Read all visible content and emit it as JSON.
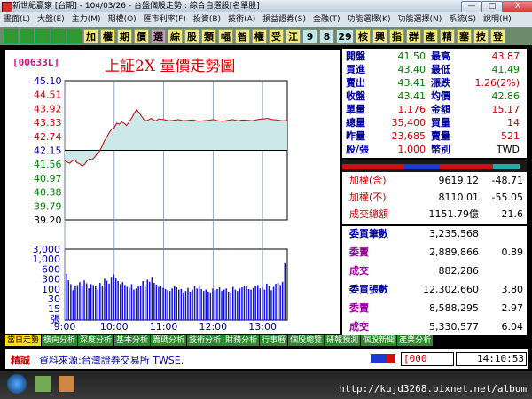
{
  "window": {
    "title": "新世紀贏家 [台期] - 104/03/26 - 台盤個股走勢 : 綜合自選股[名單股]",
    "buttons": [
      "—",
      "□",
      "X"
    ]
  },
  "menu": [
    "畫面(L)",
    "大盤(E)",
    "主力(M)",
    "期權(O)",
    "匯市利率(F)",
    "投資(B)",
    "技術(A)",
    "損益證券(S)",
    "金融(T)",
    "功能選擇(K)",
    "功能選擇(N)",
    "系統(S)",
    "說明(H)"
  ],
  "toolbar": {
    "icon_buttons": [
      "search-icon",
      "calculator-icon",
      "chart-icon",
      "grid-icon",
      "star-icon"
    ],
    "buttons": [
      "加",
      "權",
      "期",
      "價",
      "選",
      "綜",
      "股",
      "類",
      "幅",
      "智",
      "權",
      "受",
      "江",
      "9",
      "8",
      "29",
      "核",
      "興",
      "指",
      "群",
      "產",
      "精",
      "塞",
      "技",
      "登"
    ]
  },
  "stock": {
    "code": "[00633L]",
    "title": "上証2X  量價走勢圖"
  },
  "quote": [
    {
      "label": "開盤",
      "value": "41.50",
      "label2": "最高",
      "value2": "43.87"
    },
    {
      "label": "買進",
      "value": "43.40",
      "label2": "最低",
      "value2": "41.49"
    },
    {
      "label": "賣出",
      "value": "43.41",
      "label2": "漲跌",
      "value2": "1.26(2%)"
    },
    {
      "label": "收盤",
      "value": "43.41",
      "label2": "均價",
      "value2": "42.86"
    },
    {
      "label": "單量",
      "value": "1,176",
      "label2": "金額",
      "value2": "15.17"
    },
    {
      "label": "總量",
      "value": "35,400",
      "label2": "買量",
      "value2": "14"
    },
    {
      "label": "昨量",
      "value": "23,685",
      "label2": "賣量",
      "value2": "521"
    },
    {
      "label": "股/張",
      "value": "1,000",
      "label2": "幣別",
      "value2": "TWD"
    }
  ],
  "index_info": [
    {
      "label": "加權(含)",
      "value": "9619.12",
      "change": "-48.71"
    },
    {
      "label": "加權(不)",
      "value": "8110.01",
      "change": "-55.05"
    },
    {
      "label": "成交總額",
      "value": "1151.79億",
      "change": "21.6"
    }
  ],
  "volume_info": [
    {
      "label": "委買筆數",
      "value": "3,235,568",
      "change": ""
    },
    {
      "label": "委賣",
      "value": "2,889,866",
      "change": "0.89"
    },
    {
      "label": "成交",
      "value": "882,286",
      "change": ""
    },
    {
      "label": "委買張數",
      "value": "12,302,660",
      "change": "3.80"
    },
    {
      "label": "委賣",
      "value": "8,588,295",
      "change": "2.97"
    },
    {
      "label": "成交",
      "value": "5,330,577",
      "change": "6.04"
    }
  ],
  "tabs": [
    "當日走勢",
    "橫向分析",
    "深度分析",
    "基本分析",
    "籌碼分析",
    "技術分析",
    "財務分析",
    "行事曆",
    "個股總覽",
    "研報預測",
    "個股新聞",
    "產業分析"
  ],
  "status": {
    "label": "精誠",
    "source": "資料來源:台灣證券交易所 TWSE.",
    "code_box": "[000",
    "time": "14:10:53"
  },
  "watermark": "http://kujd3268.pixnet.net/album",
  "chart_data": {
    "type": "line",
    "x_ticks": [
      "9:00",
      "10:00",
      "11:00",
      "12:00",
      "13:00"
    ],
    "y_ticks": [
      "45.10",
      "44.51",
      "43.92",
      "43.33",
      "42.74",
      "42.15",
      "41.56",
      "40.97",
      "40.38",
      "39.79",
      "39.20"
    ],
    "y_tick_colors": [
      "#0000a0",
      "#d00000",
      "#d00000",
      "#d00000",
      "#d00000",
      "#0000a0",
      "#008000",
      "#008000",
      "#008000",
      "#008000",
      "#000000"
    ],
    "ylim": [
      39.2,
      45.1
    ],
    "reference_price": 42.15,
    "x_range_minutes": [
      0,
      270
    ],
    "vol_ticks": [
      "3,000",
      "1,000",
      "600",
      "300",
      "100",
      "30",
      "15",
      "張"
    ],
    "vol_max": 3000,
    "price_series": [
      [
        0,
        41.72
      ],
      [
        3,
        41.65
      ],
      [
        6,
        41.6
      ],
      [
        9,
        41.7
      ],
      [
        12,
        41.75
      ],
      [
        15,
        41.62
      ],
      [
        18,
        41.58
      ],
      [
        21,
        41.49
      ],
      [
        24,
        41.55
      ],
      [
        27,
        41.7
      ],
      [
        30,
        41.78
      ],
      [
        33,
        41.75
      ],
      [
        36,
        41.85
      ],
      [
        39,
        42.0
      ],
      [
        42,
        42.1
      ],
      [
        45,
        42.3
      ],
      [
        48,
        42.55
      ],
      [
        51,
        42.7
      ],
      [
        54,
        42.9
      ],
      [
        57,
        43.05
      ],
      [
        60,
        43.1
      ],
      [
        63,
        43.3
      ],
      [
        66,
        43.25
      ],
      [
        69,
        43.35
      ],
      [
        72,
        43.3
      ],
      [
        75,
        43.2
      ],
      [
        78,
        43.35
      ],
      [
        81,
        43.5
      ],
      [
        84,
        43.7
      ],
      [
        87,
        43.87
      ],
      [
        90,
        43.75
      ],
      [
        93,
        43.6
      ],
      [
        96,
        43.45
      ],
      [
        99,
        43.4
      ],
      [
        102,
        43.45
      ],
      [
        105,
        43.5
      ],
      [
        108,
        43.42
      ],
      [
        111,
        43.4
      ],
      [
        114,
        43.48
      ],
      [
        120,
        43.45
      ],
      [
        126,
        43.4
      ],
      [
        132,
        43.42
      ],
      [
        138,
        43.45
      ],
      [
        144,
        43.4
      ],
      [
        150,
        43.42
      ],
      [
        156,
        43.44
      ],
      [
        162,
        43.38
      ],
      [
        168,
        43.4
      ],
      [
        174,
        43.42
      ],
      [
        180,
        43.45
      ],
      [
        186,
        43.4
      ],
      [
        192,
        43.38
      ],
      [
        198,
        43.42
      ],
      [
        204,
        43.45
      ],
      [
        210,
        43.4
      ],
      [
        216,
        43.43
      ],
      [
        222,
        43.42
      ],
      [
        228,
        43.4
      ],
      [
        234,
        43.45
      ],
      [
        240,
        43.48
      ],
      [
        246,
        43.5
      ],
      [
        252,
        43.45
      ],
      [
        258,
        43.43
      ],
      [
        264,
        43.4
      ],
      [
        270,
        43.41
      ]
    ],
    "volume_series": [
      650,
      400,
      300,
      180,
      250,
      280,
      350,
      260,
      400,
      320,
      210,
      300,
      280,
      250,
      190,
      330,
      270,
      450,
      390,
      310,
      520,
      620,
      460,
      380,
      300,
      350,
      280,
      240,
      220,
      300,
      190,
      210,
      270,
      260,
      380,
      240,
      420,
      360,
      520,
      330,
      290,
      240,
      260,
      220,
      200,
      180,
      170,
      210,
      250,
      230,
      190,
      200,
      150,
      170,
      220,
      160,
      190,
      260,
      210,
      240,
      200,
      170,
      190,
      160,
      150,
      210,
      180,
      200,
      230,
      170,
      190,
      210,
      160,
      150,
      240,
      190,
      170,
      210,
      230,
      270,
      250,
      200,
      190,
      220,
      260,
      280,
      210,
      230,
      190,
      310,
      260,
      180,
      240,
      310,
      340,
      280,
      360,
      1300
    ]
  }
}
